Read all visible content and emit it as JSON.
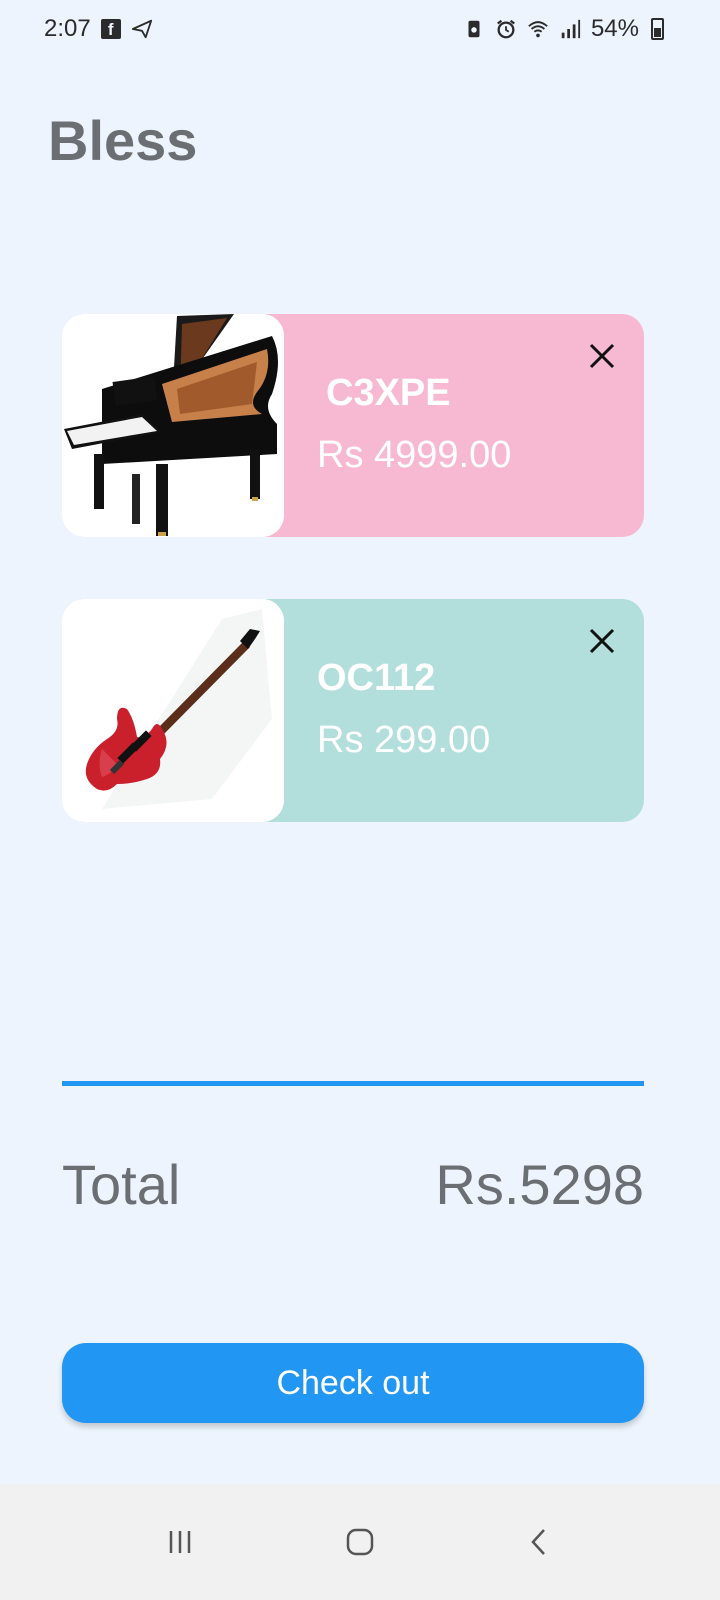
{
  "status_bar": {
    "time": "2:07",
    "battery": "54%",
    "icons": [
      "facebook-icon",
      "send-icon",
      "battery-saver-icon",
      "alarm-icon",
      "wifi-icon",
      "signal-icon",
      "battery-icon"
    ]
  },
  "app": {
    "title": "Bless"
  },
  "cart": {
    "items": [
      {
        "name": "C3XPE",
        "price": "Rs 4999.00",
        "image": "grand-piano",
        "card_color": "#f7b9d1"
      },
      {
        "name": "OC112",
        "price": "Rs 299.00",
        "image": "electric-guitar",
        "card_color": "#b2dfdb"
      }
    ]
  },
  "summary": {
    "total_label": "Total",
    "total_value": "Rs.5298"
  },
  "checkout": {
    "label": "Check out"
  },
  "colors": {
    "background": "#edf4fd",
    "accent": "#2196f3",
    "text": "#6b6f73"
  },
  "nav_bar": {
    "icons": [
      "recent-apps-icon",
      "home-icon",
      "back-icon"
    ]
  }
}
